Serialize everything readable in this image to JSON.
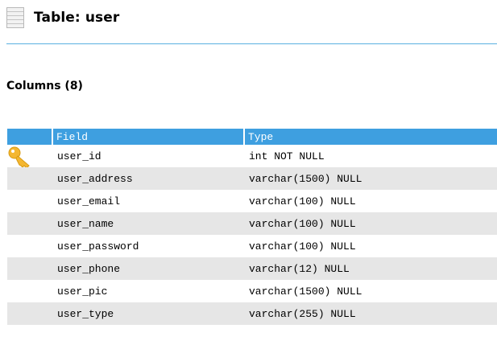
{
  "header": {
    "title": "Table: user",
    "icon": "table-icon"
  },
  "columns_section": {
    "title": "Columns (8)"
  },
  "table": {
    "headers": {
      "field": "Field",
      "type": "Type"
    },
    "rows": [
      {
        "field": "user_id",
        "type": "int NOT NULL",
        "primary_key": true
      },
      {
        "field": "user_address",
        "type": "varchar(1500) NULL",
        "primary_key": false
      },
      {
        "field": "user_email",
        "type": "varchar(100) NULL",
        "primary_key": false
      },
      {
        "field": "user_name",
        "type": "varchar(100) NULL",
        "primary_key": false
      },
      {
        "field": "user_password",
        "type": "varchar(100) NULL",
        "primary_key": false
      },
      {
        "field": "user_phone",
        "type": "varchar(12) NULL",
        "primary_key": false
      },
      {
        "field": "user_pic",
        "type": "varchar(1500) NULL",
        "primary_key": false
      },
      {
        "field": "user_type",
        "type": "varchar(255) NULL",
        "primary_key": false
      }
    ]
  },
  "colors": {
    "header_blue": "#3e9fe0",
    "divider_blue": "#5ab0e0",
    "row_alt": "#e6e6e6",
    "key_icon": "#f4b731"
  }
}
